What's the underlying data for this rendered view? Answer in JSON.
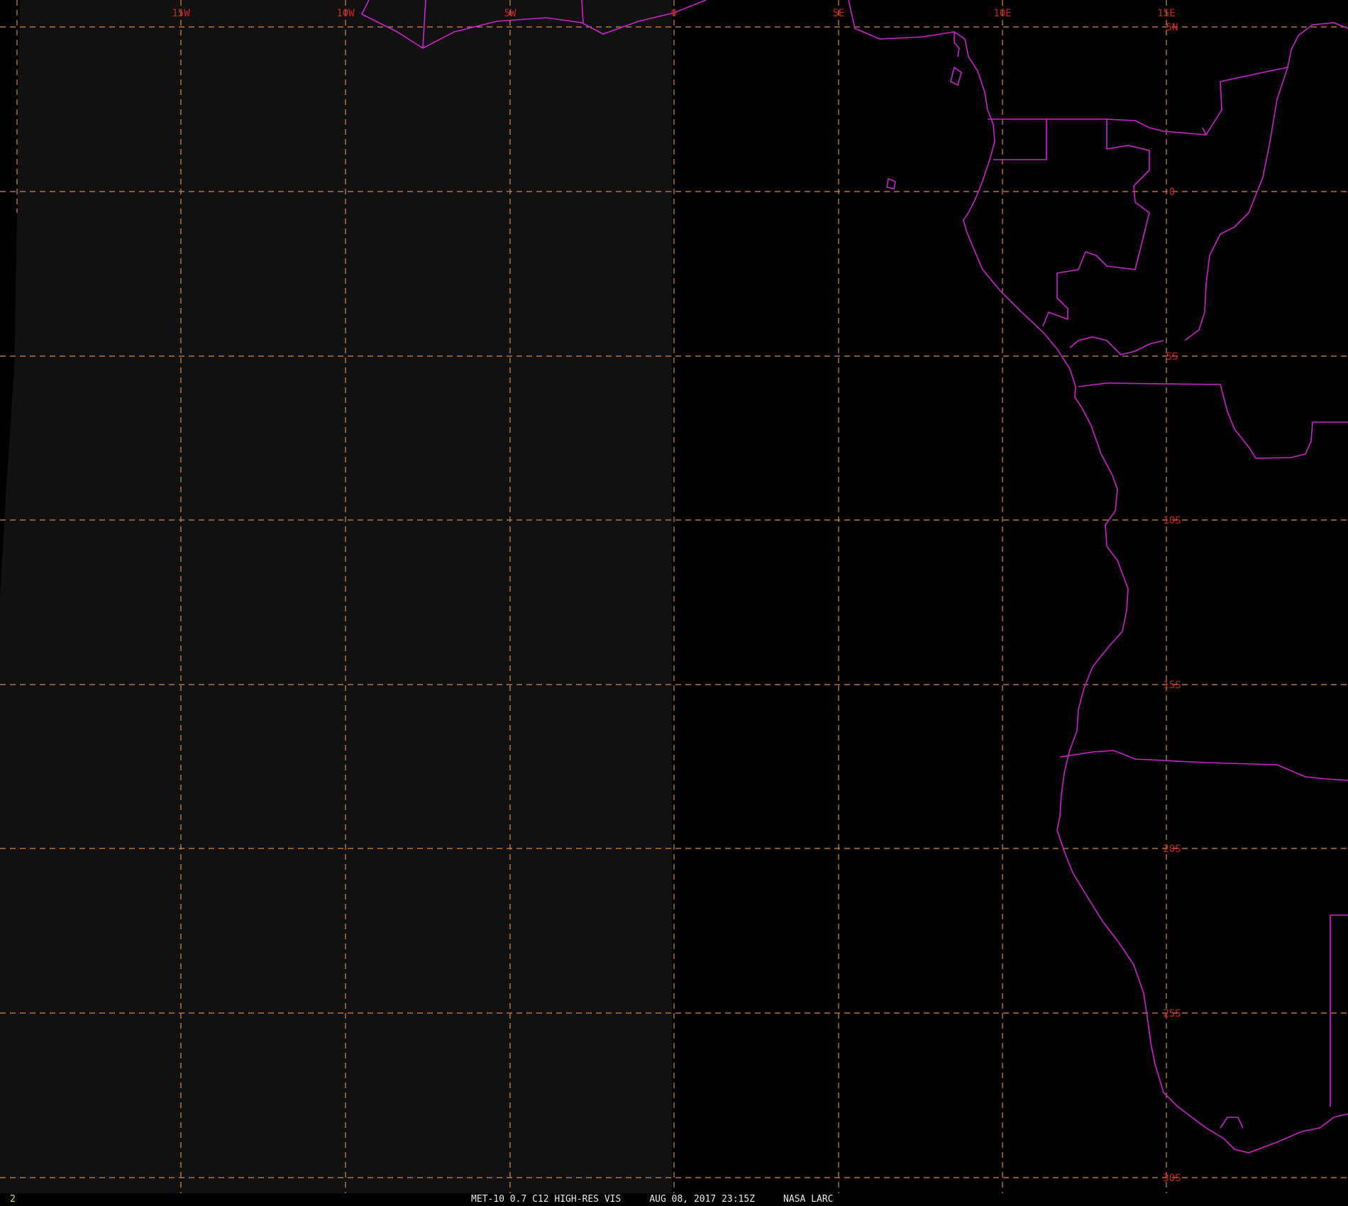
{
  "map": {
    "projection": "satellite-geostationary",
    "background_color": "#000000",
    "no_data_color": "#111111",
    "grid_color": "#d08a40",
    "grid_style": "dashed",
    "label_color": "#cc2222",
    "coastline_color": "#cc22cc",
    "longitude_labels": [
      "15W",
      "10W",
      "5W",
      "0",
      "5E",
      "10E",
      "15E"
    ],
    "latitude_labels": [
      "5N",
      "0",
      "5S",
      "10S",
      "15S",
      "20S",
      "25S",
      "30S"
    ]
  },
  "status_bar": {
    "frame_number": "2",
    "satellite_product": "MET-10 0.7 C12 HIGH-RES VIS",
    "datetime": "AUG 08, 2017 23:15Z",
    "organization": "NASA LARC"
  }
}
